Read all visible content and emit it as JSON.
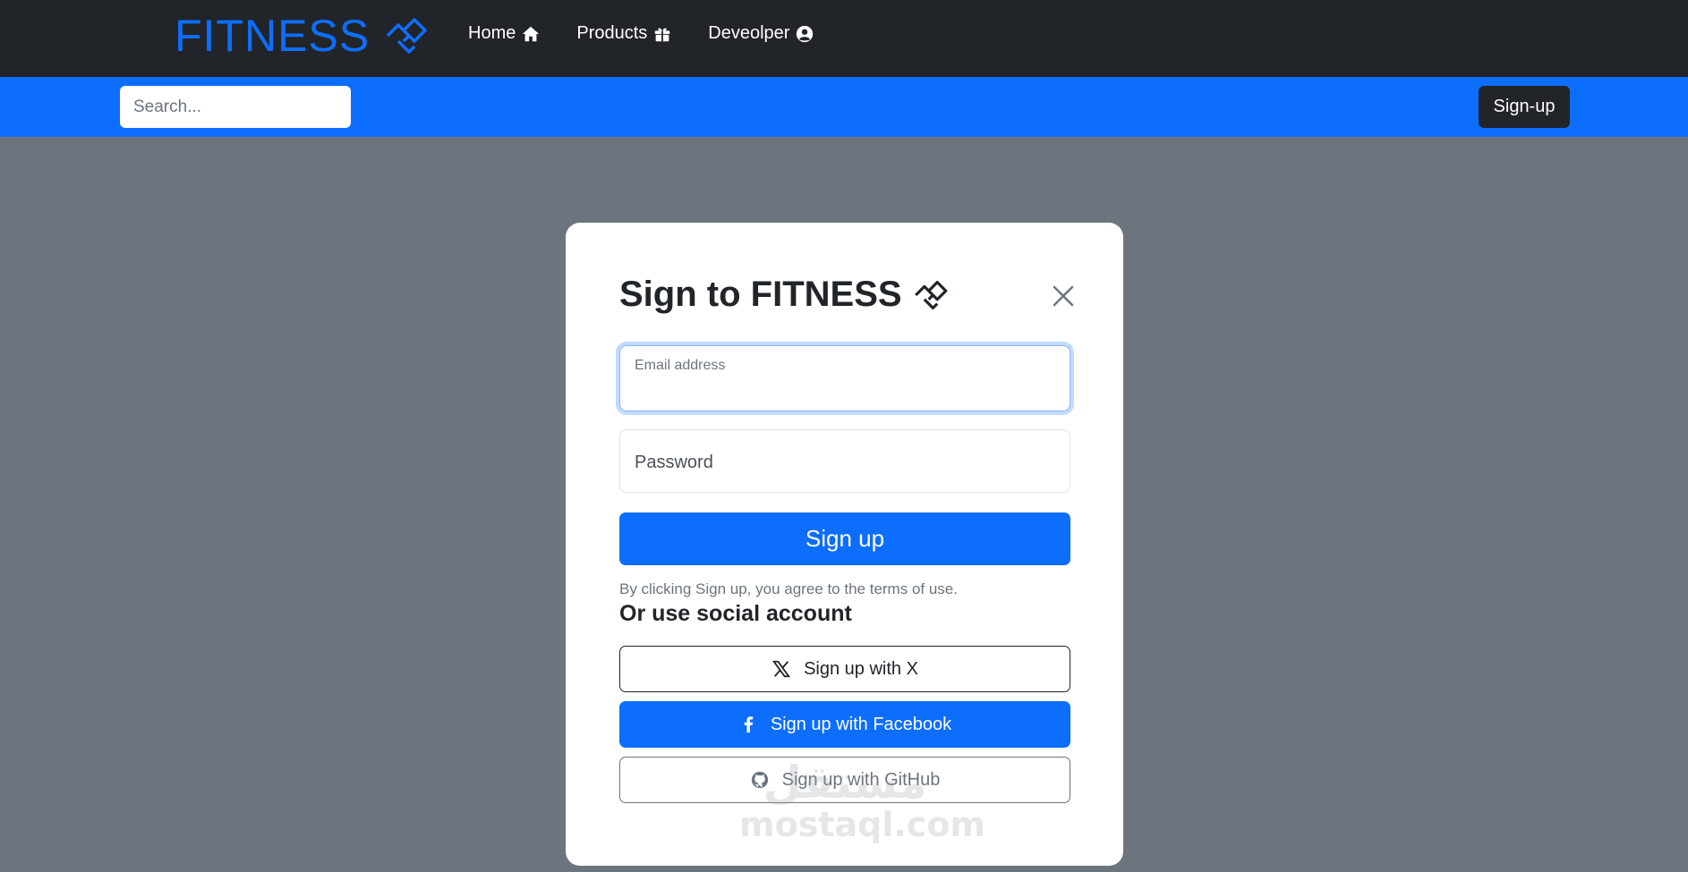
{
  "navbar": {
    "brand": "FITNESS",
    "brand_icon": "diamond-link-icon",
    "links": [
      {
        "label": "Home",
        "icon": "house-icon"
      },
      {
        "label": "Products",
        "icon": "gift-icon"
      },
      {
        "label": "Deveolper",
        "icon": "user-circle-icon"
      }
    ]
  },
  "subbar": {
    "search_placeholder": "Search...",
    "signup_label": "Sign-up"
  },
  "modal": {
    "title": "Sign to FITNESS",
    "email_label": "Email address",
    "password_label": "Password",
    "submit_label": "Sign up",
    "terms": "By clicking Sign up, you agree to the terms of use.",
    "social_heading": "Or use social account",
    "social": {
      "x_label": "Sign up with X",
      "facebook_label": "Sign up with Facebook",
      "github_label": "Sign up with GitHub"
    }
  },
  "watermark": {
    "arabic": "مستقل",
    "latin": "mostaql.com"
  },
  "colors": {
    "primary": "#0d6efd",
    "dark": "#212529",
    "backdrop": "#6c757d"
  }
}
